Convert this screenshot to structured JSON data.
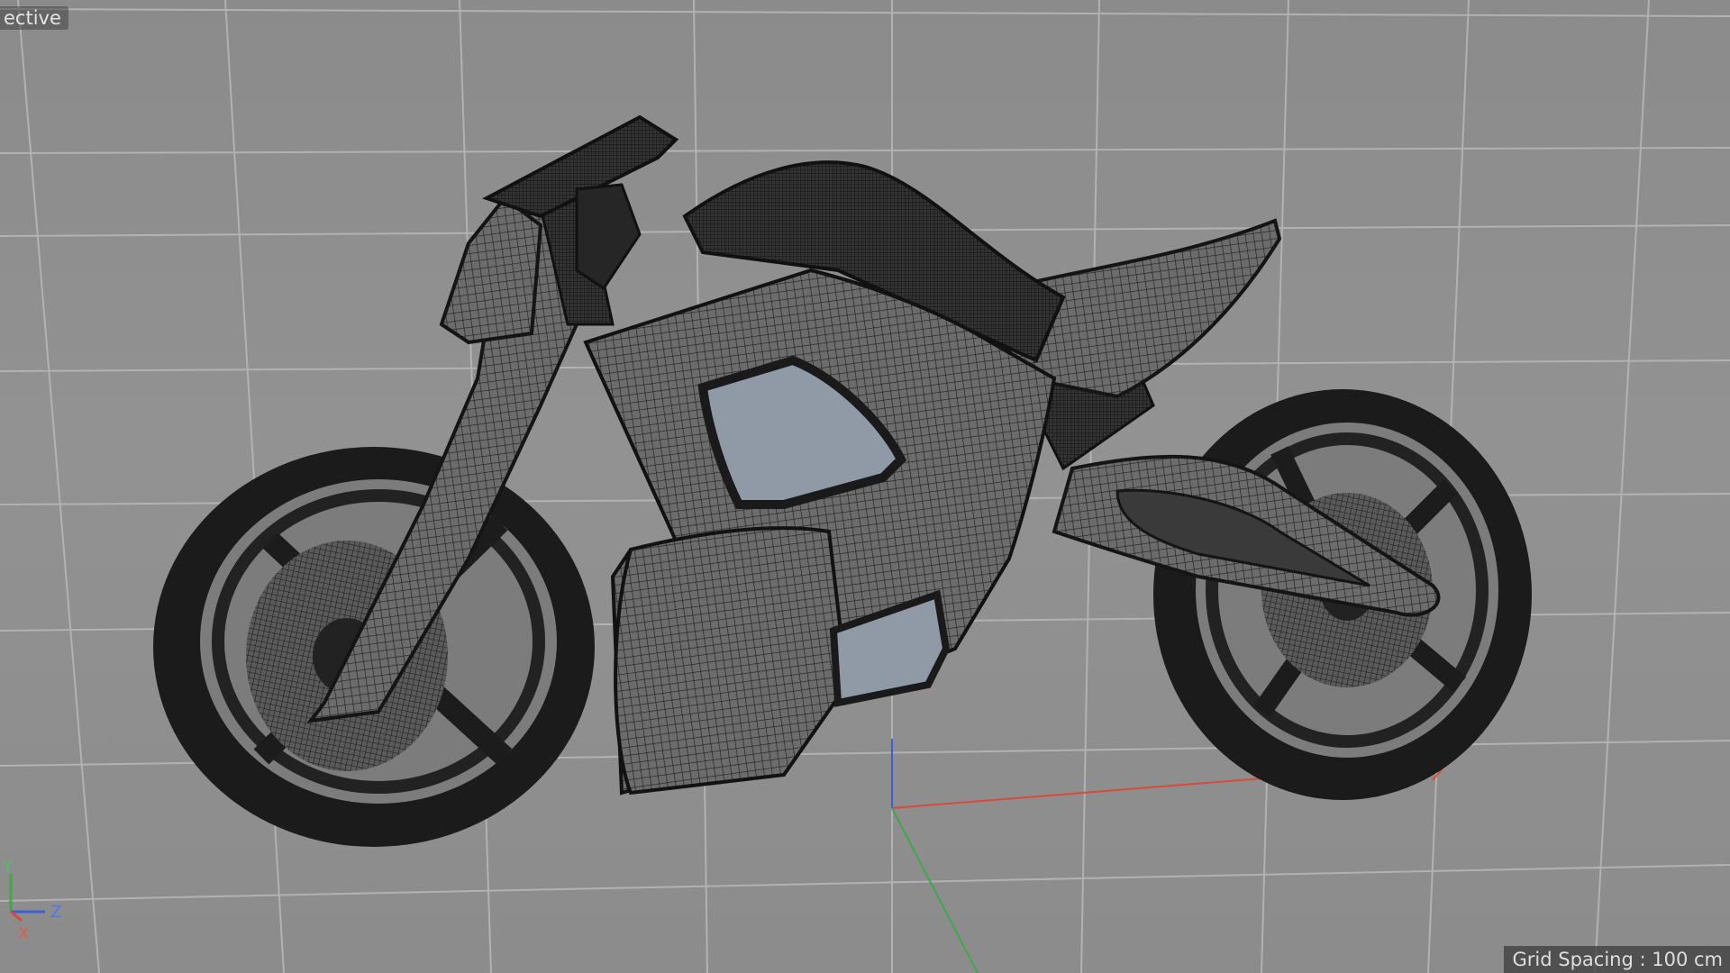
{
  "viewport": {
    "camera_label": "ective",
    "grid_spacing": "Grid Spacing : 100 cm",
    "gizmo": {
      "y_label": "Y",
      "z_label": "Z",
      "x_label": "X"
    }
  },
  "colors": {
    "background": "#8e8e8e",
    "grid_line": "#b8b8b8",
    "wireframe_dark": "#1c1c1c",
    "mesh_fill": "#6a6a6a",
    "glass": "#8f9aa6",
    "axis_x": "#d94a3a",
    "axis_y": "#3ea84a",
    "axis_z": "#3a5fd9"
  },
  "icons": [
    "axis-gizmo-icon",
    "world-origin-icon"
  ]
}
